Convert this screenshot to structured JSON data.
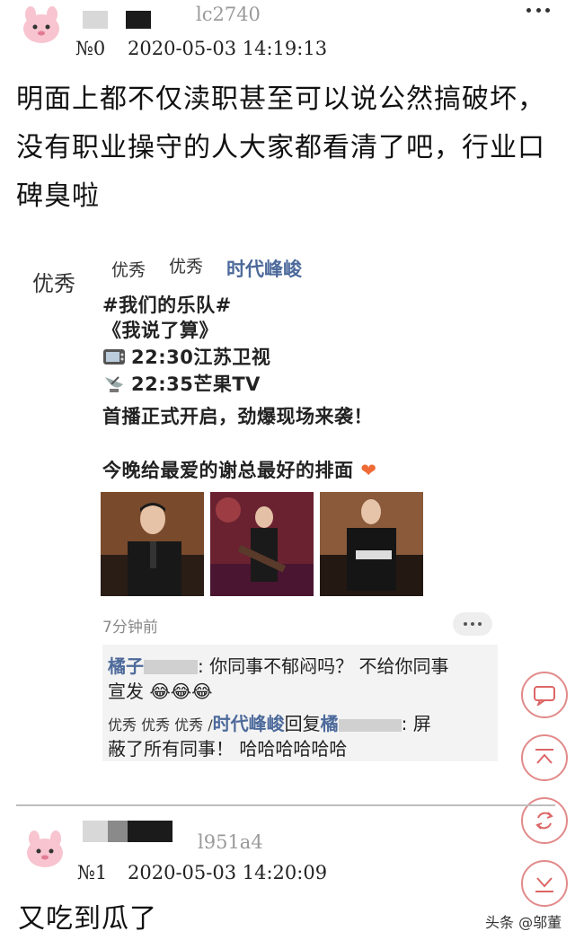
{
  "post0": {
    "uid": "lc2740",
    "floor": "№0",
    "timestamp": "2020-05-03 14:19:13",
    "lines": [
      "明面上都不仅渎职甚至可以说公然搞破坏，",
      "没有职业操守的人大家都看清了吧，行业口",
      "碑臭啦"
    ]
  },
  "embedded_weibo": {
    "author": "时代峰峻",
    "handwriting": [
      "优秀",
      "优秀",
      "优秀"
    ],
    "lines": [
      "#我们的乐队#",
      "《我说了算》",
      "22:30江苏卫视",
      "22:35芒果TV",
      "首播正式开启，劲爆现场来袭！",
      "今晚给最爱的谢总最好的排面"
    ],
    "time_ago": "7分钟前",
    "comments": [
      {
        "author": "橘子",
        "text": ": 你同事不郁闷吗？ 不给你同事",
        "text2": "宣发"
      },
      {
        "author": "时代峰峻",
        "reply_word": "回复",
        "reply_to": "橘",
        "text": ": 屏",
        "text2": "蔽了所有同事！ 哈哈哈哈哈哈"
      }
    ]
  },
  "post1": {
    "uid": "l951a4",
    "floor": "№1",
    "timestamp": "2020-05-03 14:20:09",
    "lines": [
      "又吃到瓜了"
    ]
  },
  "watermark": "头条 @邬董",
  "icons": [
    "comment-icon",
    "back-to-top-icon",
    "refresh-icon",
    "scroll-down-icon",
    "more-icon"
  ],
  "colors": {
    "accent": "#e28a8a",
    "link": "#4d6a9b"
  }
}
